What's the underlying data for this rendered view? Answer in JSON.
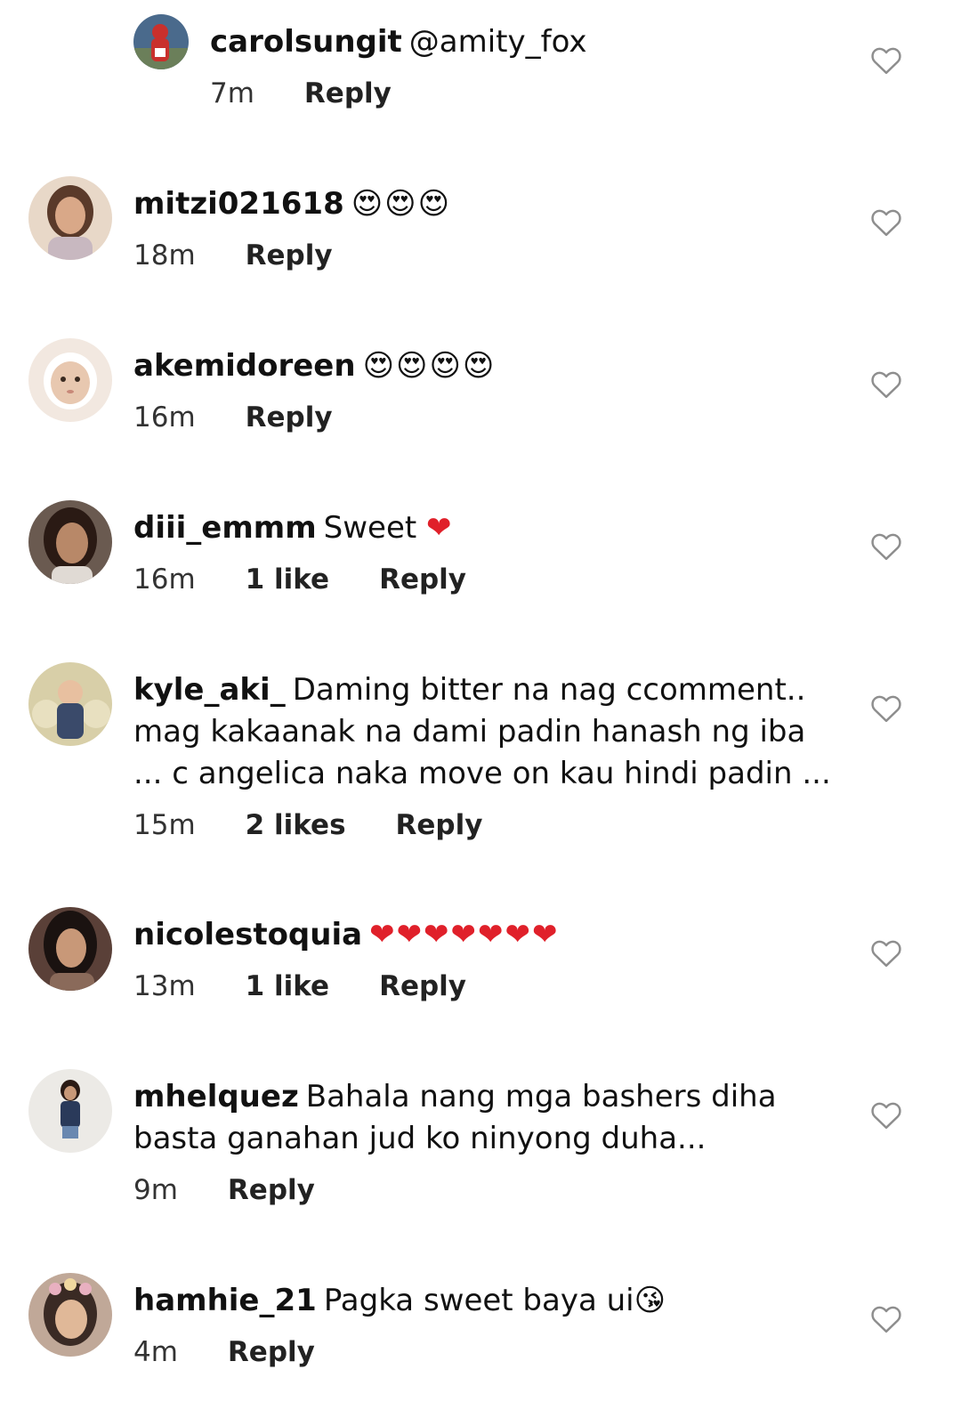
{
  "comments": [
    {
      "username": "carolsungit",
      "text": "@amity_fox",
      "emoji": "",
      "time": "7m",
      "likes": "",
      "reply_label": "Reply",
      "avatar_colors": [
        "#4a6a8c",
        "#c9302c"
      ]
    },
    {
      "username": "mitzi021618",
      "text": "",
      "emoji": "😍😍😍",
      "time": "18m",
      "likes": "",
      "reply_label": "Reply",
      "avatar_colors": [
        "#e8d8c8",
        "#5a3a2a"
      ]
    },
    {
      "username": "akemidoreen",
      "text": "",
      "emoji": "😍😍😍😍",
      "time": "16m",
      "likes": "",
      "reply_label": "Reply",
      "avatar_colors": [
        "#f2e8e0",
        "#d9b8a0"
      ]
    },
    {
      "username": "diii_emmm",
      "text": "Sweet",
      "emoji": "❤",
      "time": "16m",
      "likes": "1 like",
      "reply_label": "Reply",
      "avatar_colors": [
        "#6a5a50",
        "#2a1a14"
      ]
    },
    {
      "username": "kyle_aki_",
      "text": "Daming bitter na nag ccomment.. mag kakaanak na dami padin hanash ng iba ... c angelica naka move on kau hindi padin ...",
      "emoji": "",
      "time": "15m",
      "likes": "2 likes",
      "reply_label": "Reply",
      "avatar_colors": [
        "#d8cfa8",
        "#3a4a6a"
      ]
    },
    {
      "username": "nicolestoquia",
      "text": "",
      "emoji": "❤❤❤❤❤❤❤",
      "time": "13m",
      "likes": "1 like",
      "reply_label": "Reply",
      "avatar_colors": [
        "#5a4038",
        "#1a1210"
      ]
    },
    {
      "username": "mhelquez",
      "text": "Bahala nang mga bashers diha basta ganahan jud ko ninyong duha...",
      "emoji": "",
      "time": "9m",
      "likes": "",
      "reply_label": "Reply",
      "avatar_colors": [
        "#eceae6",
        "#2a3a5a"
      ]
    },
    {
      "username": "hamhie_21",
      "text": "Pagka sweet baya ui",
      "emoji": "😘",
      "time": "4m",
      "likes": "",
      "reply_label": "Reply",
      "avatar_colors": [
        "#c0a898",
        "#e8b0c0"
      ]
    }
  ],
  "colors": {
    "heart_emoji": "#e0202a",
    "like_icon_stroke": "#8e8e8e",
    "text": "#111111"
  }
}
